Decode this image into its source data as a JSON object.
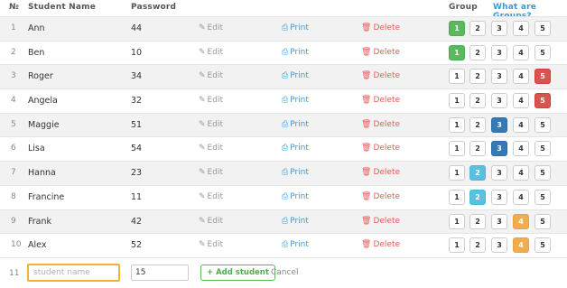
{
  "header": {
    "no": "№",
    "student_name": "Student Name",
    "password": "Password",
    "group": "Group",
    "what_are_groups": "What are Groups?"
  },
  "actions": {
    "edit": "Edit",
    "print": "Print",
    "delete": "Delete"
  },
  "icons": {
    "edit": "pencil-icon",
    "print": "printer-icon",
    "delete": "trash-icon"
  },
  "group_options": [
    "1",
    "2",
    "3",
    "4",
    "5"
  ],
  "group_colors": {
    "1": "#5cb85c",
    "2": "#5bc0de",
    "3": "#337ab7",
    "4": "#f0ad4e",
    "5": "#d9534f"
  },
  "students": [
    {
      "no": "1",
      "name": "Ann",
      "password": "44",
      "group": 1
    },
    {
      "no": "2",
      "name": "Ben",
      "password": "10",
      "group": 1
    },
    {
      "no": "3",
      "name": "Roger",
      "password": "34",
      "group": 5
    },
    {
      "no": "4",
      "name": "Angela",
      "password": "32",
      "group": 5
    },
    {
      "no": "5",
      "name": "Maggie",
      "password": "51",
      "group": 3
    },
    {
      "no": "6",
      "name": "Lisa",
      "password": "54",
      "group": 3
    },
    {
      "no": "7",
      "name": "Hanna",
      "password": "23",
      "group": 2
    },
    {
      "no": "8",
      "name": "Francine",
      "password": "11",
      "group": 2
    },
    {
      "no": "9",
      "name": "Frank",
      "password": "42",
      "group": 4
    },
    {
      "no": "10",
      "name": "Alex",
      "password": "52",
      "group": 4
    }
  ],
  "new_student": {
    "no": "11",
    "name_placeholder": "student name",
    "password_value": "15",
    "add_label": "+ Add student",
    "cancel_label": "Cancel"
  }
}
